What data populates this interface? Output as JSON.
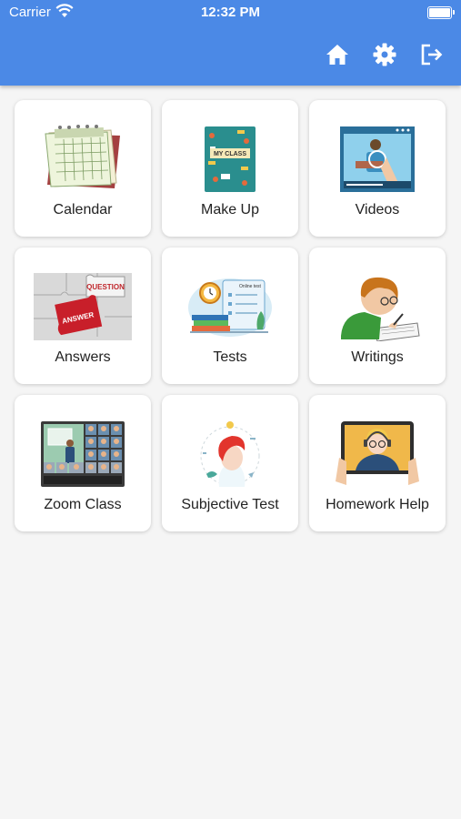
{
  "status_bar": {
    "carrier": "Carrier",
    "time": "12:32 PM"
  },
  "app_bar": {
    "actions": [
      {
        "icon": "home-icon"
      },
      {
        "icon": "gear-icon"
      },
      {
        "icon": "logout-icon"
      }
    ]
  },
  "tiles": [
    {
      "label": "Calendar",
      "icon": "calendar-icon"
    },
    {
      "label": "Make Up",
      "icon": "notebook-icon",
      "image_text": "MY CLASS"
    },
    {
      "label": "Videos",
      "icon": "video-player-icon"
    },
    {
      "label": "Answers",
      "icon": "puzzle-icon",
      "image_text": [
        "QUESTION",
        "ANSWER"
      ]
    },
    {
      "label": "Tests",
      "icon": "online-test-icon",
      "image_text": "Online test"
    },
    {
      "label": "Writings",
      "icon": "writing-boy-icon"
    },
    {
      "label": "Zoom Class",
      "icon": "video-conference-icon"
    },
    {
      "label": "Subjective Test",
      "icon": "thinking-head-icon"
    },
    {
      "label": "Homework Help",
      "icon": "tablet-tutor-icon"
    }
  ],
  "colors": {
    "app_bar": "#4b89e6",
    "background": "#f5f5f5",
    "tile": "#ffffff"
  }
}
